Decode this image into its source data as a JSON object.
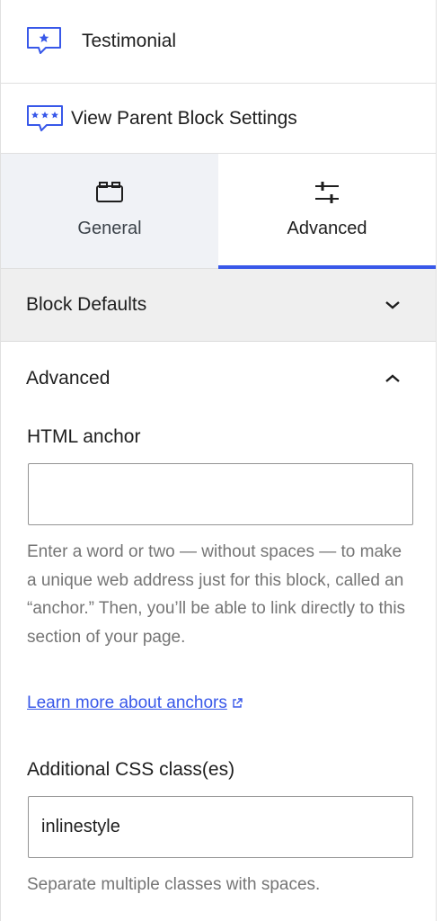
{
  "block": {
    "title": "Testimonial",
    "icon": "testimonial-icon"
  },
  "parent": {
    "label": "View Parent Block Settings",
    "icon": "parent-testimonials-icon"
  },
  "tabs": [
    {
      "label": "General",
      "icon": "general-tab-icon",
      "active": false
    },
    {
      "label": "Advanced",
      "icon": "sliders-icon",
      "active": true
    }
  ],
  "sections": {
    "block_defaults": {
      "title": "Block Defaults",
      "expanded": false
    },
    "advanced": {
      "title": "Advanced",
      "expanded": true
    }
  },
  "html_anchor": {
    "label": "HTML anchor",
    "value": "",
    "help": "Enter a word or two — without spaces — to make a unique web address just for this block, called an “anchor.” Then, you’ll be able to link directly to this section of your page.",
    "link_text": "Learn more about anchors"
  },
  "css_classes": {
    "label": "Additional CSS class(es)",
    "value": "inlinestyle",
    "help": "Separate multiple classes with spaces."
  },
  "colors": {
    "accent": "#3858e9",
    "tab_inactive_bg": "#f0f2f6",
    "section_bg": "#efefef",
    "help_text": "#757575"
  }
}
